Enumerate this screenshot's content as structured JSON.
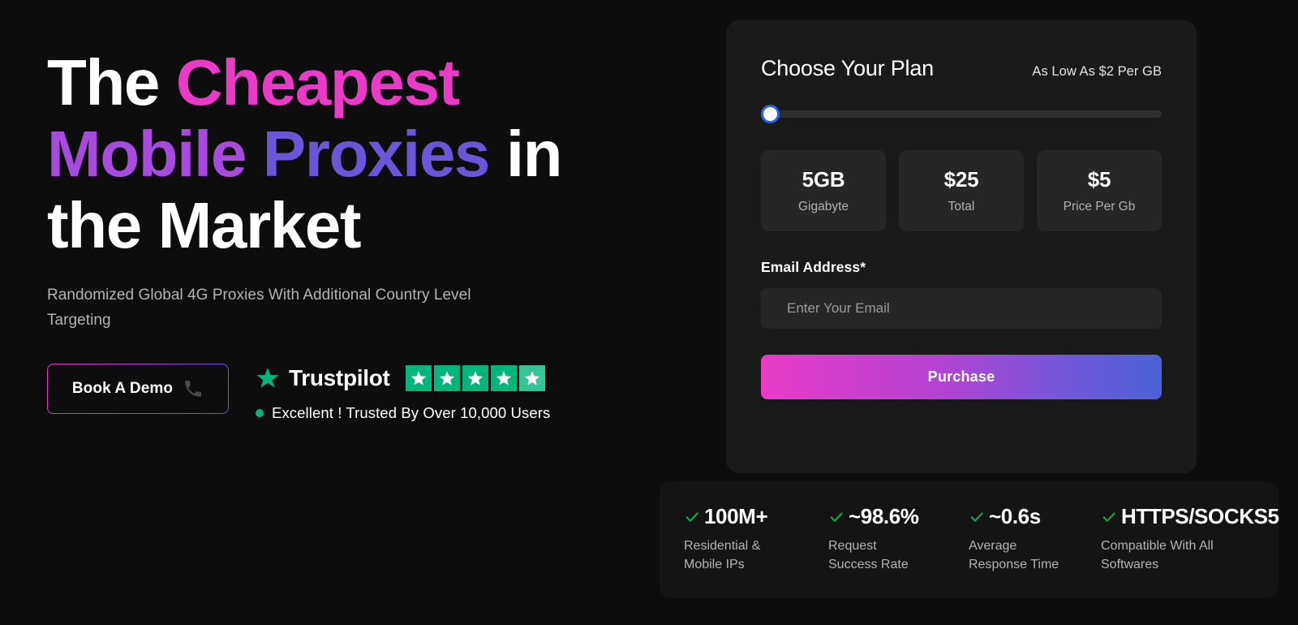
{
  "hero": {
    "headline_words": [
      {
        "text": "The ",
        "tone": "w-white"
      },
      {
        "text": "Cheapest",
        "tone": "w-pink"
      },
      {
        "text": "\n",
        "tone": "w-white"
      },
      {
        "text": "Mobile",
        "tone": "w-violet"
      },
      {
        "text": " ",
        "tone": "w-white"
      },
      {
        "text": "Proxies",
        "tone": "w-indigo"
      },
      {
        "text": " in",
        "tone": "w-white"
      },
      {
        "text": "\n",
        "tone": "w-white"
      },
      {
        "text": "the Market",
        "tone": "w-white"
      }
    ],
    "headline_plain": "The Cheapest Mobile Proxies in the Market",
    "subheading": "Randomized Global 4G Proxies With Additional Country Level Targeting",
    "demo_button": {
      "label": "Book A Demo",
      "icon": "phone-icon"
    },
    "trustpilot": {
      "brand": "Trustpilot",
      "logo_icon": "trustpilot-star-icon",
      "star_count": 5,
      "stars_filled": 4,
      "half_star": true,
      "status_dot_color": "#00b67a",
      "caption": "Excellent ! Trusted By Over 10,000 Users",
      "brand_color": "#00b67a"
    }
  },
  "plan": {
    "title": "Choose Your Plan",
    "note": "As Low As $2 Per GB",
    "slider": {
      "value_percent": 0,
      "thumb_ring_color": "#2563eb",
      "track_color": "#2e2e2e"
    },
    "stats": [
      {
        "value": "5GB",
        "label": "Gigabyte"
      },
      {
        "value": "$25",
        "label": "Total"
      },
      {
        "value": "$5",
        "label": "Price Per Gb"
      }
    ],
    "email": {
      "label": "Email Address*",
      "placeholder": "Enter Your Email",
      "value": ""
    },
    "purchase_label": "Purchase",
    "gradient": {
      "from": "#e93bc8",
      "mid": "#8b4bd8",
      "to": "#4a63d8"
    }
  },
  "trust_bar": {
    "check_color": "#16a34a",
    "items": [
      {
        "value": "100M+",
        "desc": "Residential &\nMobile IPs"
      },
      {
        "value": "~98.6%",
        "desc": "Request\nSuccess Rate"
      },
      {
        "value": "~0.6s",
        "desc": "Average\nResponse Time"
      },
      {
        "value": "HTTPS/SOCKS5",
        "desc": "Compatible With All\nSoftwares"
      }
    ]
  }
}
